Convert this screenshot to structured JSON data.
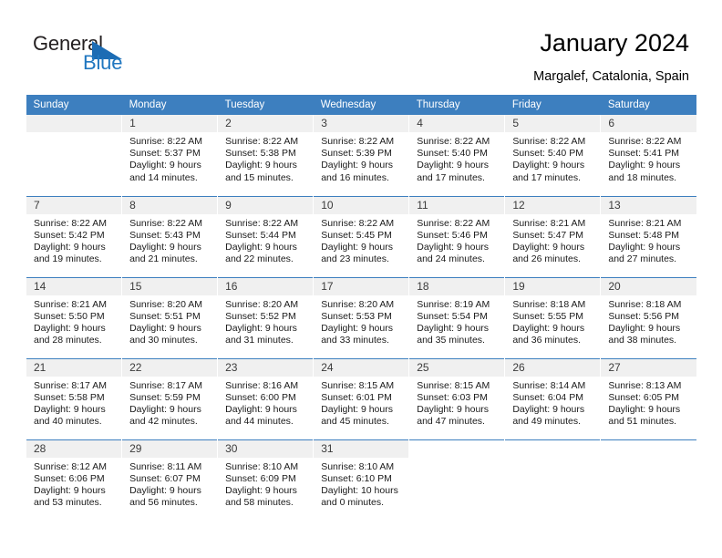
{
  "brand": {
    "general": "General",
    "blue": "Blue",
    "triangle_color": "#1c6cb4",
    "blue_color": "#2077c0"
  },
  "header": {
    "title": "January 2024",
    "subtitle": "Margalef, Catalonia, Spain",
    "header_bg": "#3d7fbf",
    "daynum_bg": "#f0f0f0"
  },
  "weekday_headers": [
    "Sunday",
    "Monday",
    "Tuesday",
    "Wednesday",
    "Thursday",
    "Friday",
    "Saturday"
  ],
  "weeks": [
    [
      {
        "day": "",
        "sunrise": "",
        "sunset": "",
        "daylight1": "",
        "daylight2": ""
      },
      {
        "day": "1",
        "sunrise": "Sunrise: 8:22 AM",
        "sunset": "Sunset: 5:37 PM",
        "daylight1": "Daylight: 9 hours",
        "daylight2": "and 14 minutes."
      },
      {
        "day": "2",
        "sunrise": "Sunrise: 8:22 AM",
        "sunset": "Sunset: 5:38 PM",
        "daylight1": "Daylight: 9 hours",
        "daylight2": "and 15 minutes."
      },
      {
        "day": "3",
        "sunrise": "Sunrise: 8:22 AM",
        "sunset": "Sunset: 5:39 PM",
        "daylight1": "Daylight: 9 hours",
        "daylight2": "and 16 minutes."
      },
      {
        "day": "4",
        "sunrise": "Sunrise: 8:22 AM",
        "sunset": "Sunset: 5:40 PM",
        "daylight1": "Daylight: 9 hours",
        "daylight2": "and 17 minutes."
      },
      {
        "day": "5",
        "sunrise": "Sunrise: 8:22 AM",
        "sunset": "Sunset: 5:40 PM",
        "daylight1": "Daylight: 9 hours",
        "daylight2": "and 17 minutes."
      },
      {
        "day": "6",
        "sunrise": "Sunrise: 8:22 AM",
        "sunset": "Sunset: 5:41 PM",
        "daylight1": "Daylight: 9 hours",
        "daylight2": "and 18 minutes."
      }
    ],
    [
      {
        "day": "7",
        "sunrise": "Sunrise: 8:22 AM",
        "sunset": "Sunset: 5:42 PM",
        "daylight1": "Daylight: 9 hours",
        "daylight2": "and 19 minutes."
      },
      {
        "day": "8",
        "sunrise": "Sunrise: 8:22 AM",
        "sunset": "Sunset: 5:43 PM",
        "daylight1": "Daylight: 9 hours",
        "daylight2": "and 21 minutes."
      },
      {
        "day": "9",
        "sunrise": "Sunrise: 8:22 AM",
        "sunset": "Sunset: 5:44 PM",
        "daylight1": "Daylight: 9 hours",
        "daylight2": "and 22 minutes."
      },
      {
        "day": "10",
        "sunrise": "Sunrise: 8:22 AM",
        "sunset": "Sunset: 5:45 PM",
        "daylight1": "Daylight: 9 hours",
        "daylight2": "and 23 minutes."
      },
      {
        "day": "11",
        "sunrise": "Sunrise: 8:22 AM",
        "sunset": "Sunset: 5:46 PM",
        "daylight1": "Daylight: 9 hours",
        "daylight2": "and 24 minutes."
      },
      {
        "day": "12",
        "sunrise": "Sunrise: 8:21 AM",
        "sunset": "Sunset: 5:47 PM",
        "daylight1": "Daylight: 9 hours",
        "daylight2": "and 26 minutes."
      },
      {
        "day": "13",
        "sunrise": "Sunrise: 8:21 AM",
        "sunset": "Sunset: 5:48 PM",
        "daylight1": "Daylight: 9 hours",
        "daylight2": "and 27 minutes."
      }
    ],
    [
      {
        "day": "14",
        "sunrise": "Sunrise: 8:21 AM",
        "sunset": "Sunset: 5:50 PM",
        "daylight1": "Daylight: 9 hours",
        "daylight2": "and 28 minutes."
      },
      {
        "day": "15",
        "sunrise": "Sunrise: 8:20 AM",
        "sunset": "Sunset: 5:51 PM",
        "daylight1": "Daylight: 9 hours",
        "daylight2": "and 30 minutes."
      },
      {
        "day": "16",
        "sunrise": "Sunrise: 8:20 AM",
        "sunset": "Sunset: 5:52 PM",
        "daylight1": "Daylight: 9 hours",
        "daylight2": "and 31 minutes."
      },
      {
        "day": "17",
        "sunrise": "Sunrise: 8:20 AM",
        "sunset": "Sunset: 5:53 PM",
        "daylight1": "Daylight: 9 hours",
        "daylight2": "and 33 minutes."
      },
      {
        "day": "18",
        "sunrise": "Sunrise: 8:19 AM",
        "sunset": "Sunset: 5:54 PM",
        "daylight1": "Daylight: 9 hours",
        "daylight2": "and 35 minutes."
      },
      {
        "day": "19",
        "sunrise": "Sunrise: 8:18 AM",
        "sunset": "Sunset: 5:55 PM",
        "daylight1": "Daylight: 9 hours",
        "daylight2": "and 36 minutes."
      },
      {
        "day": "20",
        "sunrise": "Sunrise: 8:18 AM",
        "sunset": "Sunset: 5:56 PM",
        "daylight1": "Daylight: 9 hours",
        "daylight2": "and 38 minutes."
      }
    ],
    [
      {
        "day": "21",
        "sunrise": "Sunrise: 8:17 AM",
        "sunset": "Sunset: 5:58 PM",
        "daylight1": "Daylight: 9 hours",
        "daylight2": "and 40 minutes."
      },
      {
        "day": "22",
        "sunrise": "Sunrise: 8:17 AM",
        "sunset": "Sunset: 5:59 PM",
        "daylight1": "Daylight: 9 hours",
        "daylight2": "and 42 minutes."
      },
      {
        "day": "23",
        "sunrise": "Sunrise: 8:16 AM",
        "sunset": "Sunset: 6:00 PM",
        "daylight1": "Daylight: 9 hours",
        "daylight2": "and 44 minutes."
      },
      {
        "day": "24",
        "sunrise": "Sunrise: 8:15 AM",
        "sunset": "Sunset: 6:01 PM",
        "daylight1": "Daylight: 9 hours",
        "daylight2": "and 45 minutes."
      },
      {
        "day": "25",
        "sunrise": "Sunrise: 8:15 AM",
        "sunset": "Sunset: 6:03 PM",
        "daylight1": "Daylight: 9 hours",
        "daylight2": "and 47 minutes."
      },
      {
        "day": "26",
        "sunrise": "Sunrise: 8:14 AM",
        "sunset": "Sunset: 6:04 PM",
        "daylight1": "Daylight: 9 hours",
        "daylight2": "and 49 minutes."
      },
      {
        "day": "27",
        "sunrise": "Sunrise: 8:13 AM",
        "sunset": "Sunset: 6:05 PM",
        "daylight1": "Daylight: 9 hours",
        "daylight2": "and 51 minutes."
      }
    ],
    [
      {
        "day": "28",
        "sunrise": "Sunrise: 8:12 AM",
        "sunset": "Sunset: 6:06 PM",
        "daylight1": "Daylight: 9 hours",
        "daylight2": "and 53 minutes."
      },
      {
        "day": "29",
        "sunrise": "Sunrise: 8:11 AM",
        "sunset": "Sunset: 6:07 PM",
        "daylight1": "Daylight: 9 hours",
        "daylight2": "and 56 minutes."
      },
      {
        "day": "30",
        "sunrise": "Sunrise: 8:10 AM",
        "sunset": "Sunset: 6:09 PM",
        "daylight1": "Daylight: 9 hours",
        "daylight2": "and 58 minutes."
      },
      {
        "day": "31",
        "sunrise": "Sunrise: 8:10 AM",
        "sunset": "Sunset: 6:10 PM",
        "daylight1": "Daylight: 10 hours",
        "daylight2": "and 0 minutes."
      },
      {
        "day": "",
        "sunrise": "",
        "sunset": "",
        "daylight1": "",
        "daylight2": ""
      },
      {
        "day": "",
        "sunrise": "",
        "sunset": "",
        "daylight1": "",
        "daylight2": ""
      },
      {
        "day": "",
        "sunrise": "",
        "sunset": "",
        "daylight1": "",
        "daylight2": ""
      }
    ]
  ]
}
